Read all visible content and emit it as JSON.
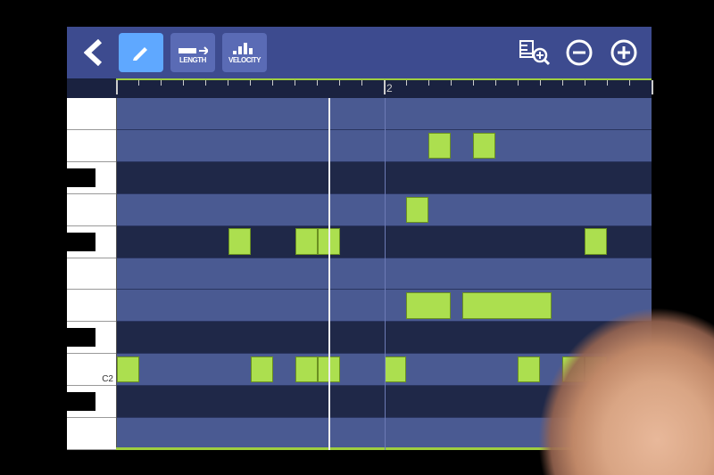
{
  "toolbar": {
    "length_label": "LENGTH",
    "velocity_label": "VELOCITY"
  },
  "ruler": {
    "measure_label": "2",
    "ticks_per_measure": 16
  },
  "piano": {
    "label_c2": "C2"
  },
  "grid": {
    "steps_per_measure": 16,
    "visible_steps": 24,
    "playhead_step": 9.5,
    "rows": [
      {
        "type": "white",
        "notes": []
      },
      {
        "type": "white",
        "notes": [
          {
            "start": 14,
            "len": 1
          },
          {
            "start": 16,
            "len": 1
          }
        ]
      },
      {
        "type": "black",
        "notes": []
      },
      {
        "type": "white",
        "notes": [
          {
            "start": 13,
            "len": 1
          }
        ]
      },
      {
        "type": "black",
        "notes": [
          {
            "start": 5,
            "len": 1
          },
          {
            "start": 8,
            "len": 1
          },
          {
            "start": 9,
            "len": 1
          },
          {
            "start": 21,
            "len": 1
          }
        ]
      },
      {
        "type": "white",
        "notes": []
      },
      {
        "type": "white",
        "notes": [
          {
            "start": 13,
            "len": 2
          },
          {
            "start": 15.5,
            "len": 4
          }
        ]
      },
      {
        "type": "black",
        "notes": []
      },
      {
        "type": "white",
        "notes": [
          {
            "start": 0,
            "len": 1
          },
          {
            "start": 6,
            "len": 1
          },
          {
            "start": 8,
            "len": 1
          },
          {
            "start": 9,
            "len": 1
          },
          {
            "start": 12,
            "len": 1
          },
          {
            "start": 18,
            "len": 1
          },
          {
            "start": 20,
            "len": 1
          },
          {
            "start": 21,
            "len": 1
          }
        ]
      },
      {
        "type": "black",
        "notes": []
      },
      {
        "type": "white",
        "notes": []
      }
    ]
  }
}
